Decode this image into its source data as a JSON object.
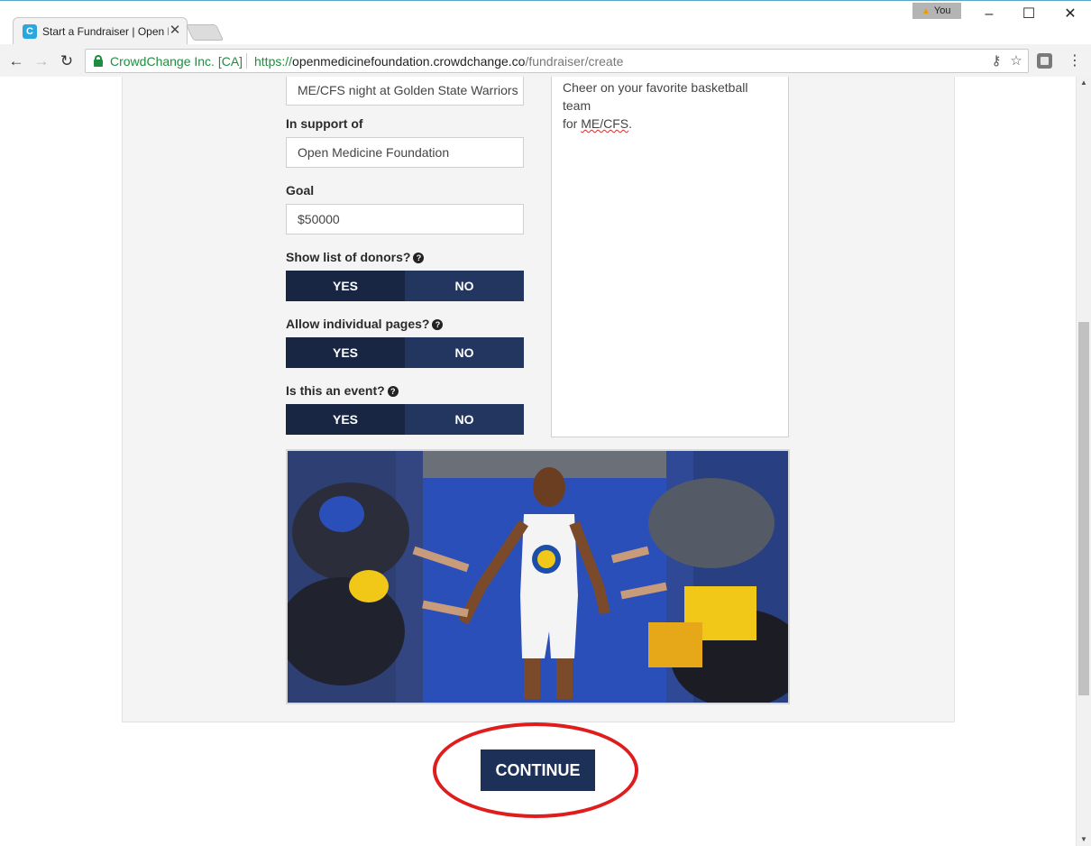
{
  "browser": {
    "tab_title": "Start a Fundraiser | Open Medicine Foundation",
    "tab_favicon": "crowdchange-favicon",
    "profile_name": "You",
    "site_name": "CrowdChange Inc. [CA]",
    "url_scheme": "https://",
    "url_host": "openmedicinefoundation.crowdchange.co",
    "url_path": "/fundraiser/create",
    "icons": [
      "back-icon",
      "forward-icon",
      "reload-icon",
      "lock-icon",
      "key-icon",
      "star-icon",
      "extension-icon",
      "menu-icon"
    ]
  },
  "form": {
    "title_value": "ME/CFS night at Golden State Warriors",
    "support_label": "In support of",
    "support_value": "Open Medicine Foundation",
    "goal_label": "Goal",
    "goal_value": "$50000",
    "donors_label": "Show list of donors?",
    "individual_label": "Allow individual pages?",
    "event_label": "Is this an event?",
    "yes_label": "YES",
    "no_label": "NO",
    "description_line1": "Cheer on your favorite basketball team",
    "description_line2_prefix": "for ",
    "description_line2_word": "ME/CFS",
    "description_line2_suffix": "."
  },
  "continue_label": "CONTINUE",
  "colors": {
    "toggle_selected": "#182644",
    "toggle_unselected": "#223660",
    "continue_bg": "#1d3158",
    "highlight": "#e01d1d"
  }
}
